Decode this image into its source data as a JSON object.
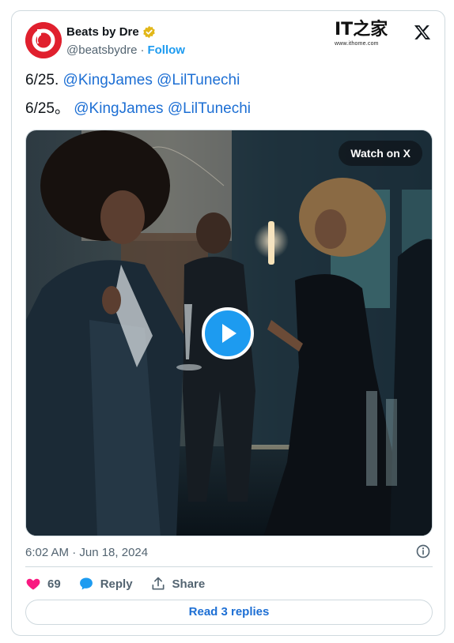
{
  "author": {
    "display_name": "Beats by Dre",
    "handle": "@beatsbydre",
    "separator": "·",
    "follow_label": "Follow"
  },
  "watermark": {
    "brand": "IT之家",
    "url": "www.ithome.com"
  },
  "tweet": {
    "line1": {
      "prefix": "6/25. ",
      "mention1": "@KingJames",
      "space": " ",
      "mention2": "@LilTunechi"
    },
    "line2": {
      "prefix": "6/25。 ",
      "mention1": "@KingJames",
      "space": " ",
      "mention2": "@LilTunechi"
    }
  },
  "media": {
    "watch_label": "Watch on X"
  },
  "meta": {
    "timestamp": "6:02 AM · Jun 18, 2024"
  },
  "actions": {
    "likes": "69",
    "reply_label": "Reply",
    "share_label": "Share"
  },
  "footer": {
    "read_replies_label": "Read 3 replies"
  },
  "colors": {
    "accent": "#1d9bf0",
    "link": "#1d6fd4",
    "like": "#f91880",
    "brand_red": "#e0202e"
  }
}
